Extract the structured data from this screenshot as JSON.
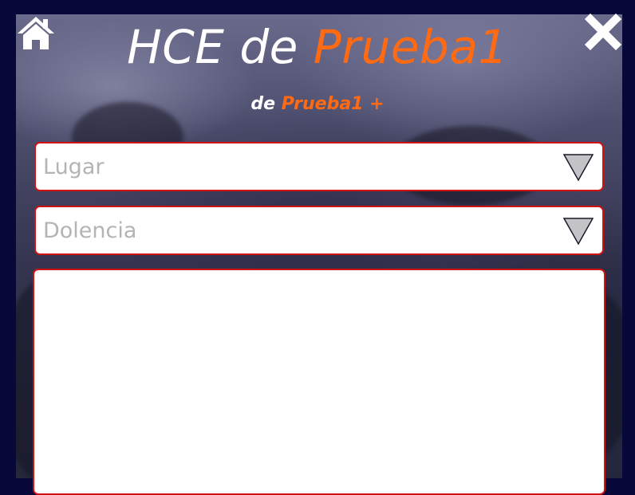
{
  "header": {
    "title_prefix": "HCE de ",
    "title_name": "Prueba1",
    "subtitle_prefix": "de ",
    "subtitle_name": "Prueba1 +"
  },
  "icons": {
    "home": "home-icon",
    "close": "close-icon",
    "dropdown": "triangle-down-icon"
  },
  "form": {
    "lugar": {
      "placeholder": "Lugar"
    },
    "dolencia": {
      "placeholder": "Dolencia"
    },
    "notes": {
      "value": ""
    }
  },
  "colors": {
    "accent": "#ff6a12",
    "border": "#d01212",
    "page_background": "#07073a"
  }
}
